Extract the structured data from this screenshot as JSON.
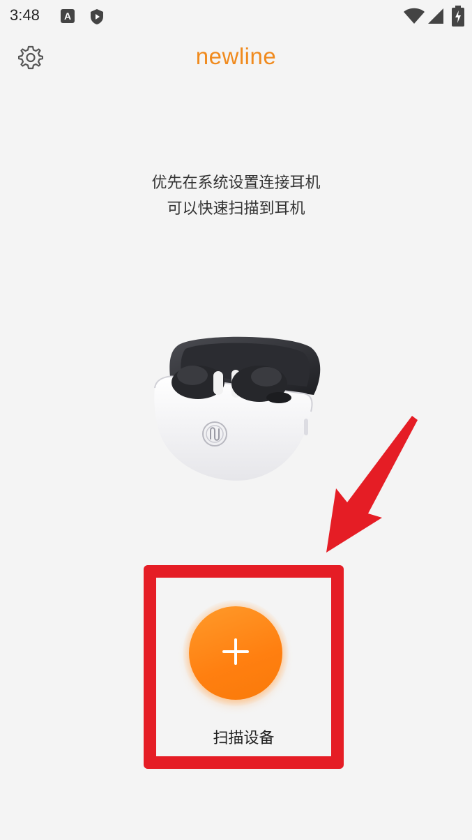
{
  "status_bar": {
    "time": "3:48",
    "icons": [
      "a-notification-icon",
      "shield-icon",
      "wifi-icon",
      "signal-icon",
      "battery-charging-icon"
    ]
  },
  "header": {
    "logo": "newline",
    "settings_icon": "gear-icon"
  },
  "hint": {
    "line1": "优先在系统设置连接耳机",
    "line2": "可以快速扫描到耳机"
  },
  "product_image": "earbuds-case-image",
  "scan": {
    "label": "扫描设备",
    "icon": "plus-icon"
  },
  "colors": {
    "accent": "#ff8a1a",
    "logo": "#f08a1d",
    "highlight": "#e51d25",
    "background": "#f4f4f4"
  }
}
